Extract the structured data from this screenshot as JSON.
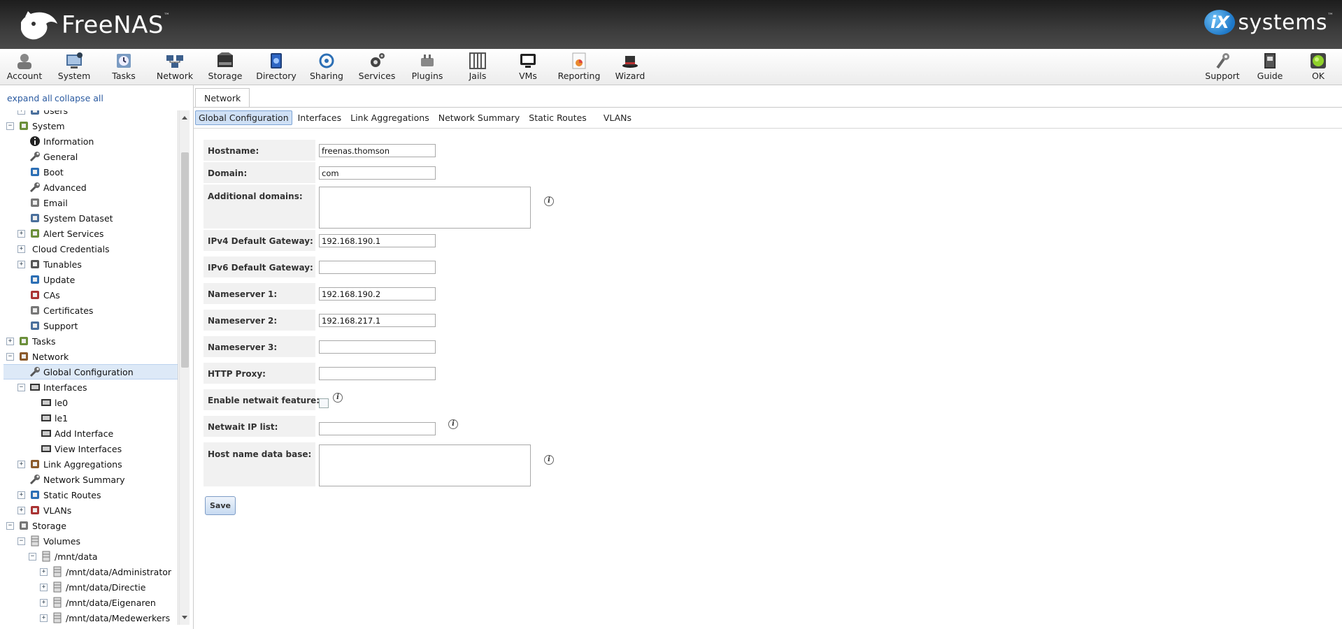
{
  "header": {
    "brand": "FreeNAS",
    "brand_tm": "™",
    "partner": "systems",
    "partner_mark": "iX",
    "partner_tm": "™"
  },
  "toolbar": {
    "items": [
      {
        "label": "Account",
        "icon": "account-icon"
      },
      {
        "label": "System",
        "icon": "system-icon"
      },
      {
        "label": "Tasks",
        "icon": "tasks-icon"
      },
      {
        "label": "Network",
        "icon": "network-icon"
      },
      {
        "label": "Storage",
        "icon": "storage-icon"
      },
      {
        "label": "Directory",
        "icon": "directory-icon"
      },
      {
        "label": "Sharing",
        "icon": "sharing-icon"
      },
      {
        "label": "Services",
        "icon": "services-icon"
      },
      {
        "label": "Plugins",
        "icon": "plugins-icon"
      },
      {
        "label": "Jails",
        "icon": "jails-icon"
      },
      {
        "label": "VMs",
        "icon": "vms-icon"
      },
      {
        "label": "Reporting",
        "icon": "reporting-icon"
      },
      {
        "label": "Wizard",
        "icon": "wizard-icon"
      }
    ],
    "right_items": [
      {
        "label": "Support",
        "icon": "support-icon"
      },
      {
        "label": "Guide",
        "icon": "guide-icon"
      },
      {
        "label": "OK",
        "icon": "alert-ok-icon"
      }
    ]
  },
  "tree": {
    "expand_all": "expand all",
    "collapse_all": "collapse all",
    "rows": [
      {
        "label": "Users",
        "level": 1,
        "exp": "+",
        "icon": "users-icon"
      },
      {
        "label": "System",
        "level": 0,
        "exp": "−",
        "icon": "system-icon"
      },
      {
        "label": "Information",
        "level": 1,
        "exp": "",
        "icon": "info-icon"
      },
      {
        "label": "General",
        "level": 1,
        "exp": "",
        "icon": "wrench-icon"
      },
      {
        "label": "Boot",
        "level": 1,
        "exp": "",
        "icon": "boot-icon"
      },
      {
        "label": "Advanced",
        "level": 1,
        "exp": "",
        "icon": "wrench-icon"
      },
      {
        "label": "Email",
        "level": 1,
        "exp": "",
        "icon": "email-icon"
      },
      {
        "label": "System Dataset",
        "level": 1,
        "exp": "",
        "icon": "dataset-icon"
      },
      {
        "label": "Alert Services",
        "level": 1,
        "exp": "+",
        "icon": "alert-icon"
      },
      {
        "label": "Cloud Credentials",
        "level": 1,
        "exp": "+",
        "icon": ""
      },
      {
        "label": "Tunables",
        "level": 1,
        "exp": "+",
        "icon": "tunables-icon"
      },
      {
        "label": "Update",
        "level": 1,
        "exp": "",
        "icon": "update-icon"
      },
      {
        "label": "CAs",
        "level": 1,
        "exp": "",
        "icon": "ca-icon"
      },
      {
        "label": "Certificates",
        "level": 1,
        "exp": "",
        "icon": "certificate-icon"
      },
      {
        "label": "Support",
        "level": 1,
        "exp": "",
        "icon": "support-icon"
      },
      {
        "label": "Tasks",
        "level": 0,
        "exp": "+",
        "icon": "tasks-icon"
      },
      {
        "label": "Network",
        "level": 0,
        "exp": "−",
        "icon": "network-icon"
      },
      {
        "label": "Global Configuration",
        "level": 1,
        "exp": "",
        "icon": "wrench-icon",
        "selected": true
      },
      {
        "label": "Interfaces",
        "level": 1,
        "exp": "−",
        "icon": "interface-icon"
      },
      {
        "label": "le0",
        "level": 2,
        "exp": "",
        "icon": "interface-icon"
      },
      {
        "label": "le1",
        "level": 2,
        "exp": "",
        "icon": "interface-icon"
      },
      {
        "label": "Add Interface",
        "level": 2,
        "exp": "",
        "icon": "add-interface-icon"
      },
      {
        "label": "View Interfaces",
        "level": 2,
        "exp": "",
        "icon": "view-interfaces-icon"
      },
      {
        "label": "Link Aggregations",
        "level": 1,
        "exp": "+",
        "icon": "link-aggregation-icon"
      },
      {
        "label": "Network Summary",
        "level": 1,
        "exp": "",
        "icon": "wrench-icon"
      },
      {
        "label": "Static Routes",
        "level": 1,
        "exp": "+",
        "icon": "static-routes-icon"
      },
      {
        "label": "VLANs",
        "level": 1,
        "exp": "+",
        "icon": "vlan-icon"
      },
      {
        "label": "Storage",
        "level": 0,
        "exp": "−",
        "icon": "storage-icon"
      },
      {
        "label": "Volumes",
        "level": 1,
        "exp": "−",
        "icon": "volume-icon"
      },
      {
        "label": "/mnt/data",
        "level": 2,
        "exp": "−",
        "icon": "volume-icon"
      },
      {
        "label": "/mnt/data/Administrator",
        "level": 3,
        "exp": "+",
        "icon": "volume-icon"
      },
      {
        "label": "/mnt/data/Directie",
        "level": 3,
        "exp": "+",
        "icon": "volume-icon"
      },
      {
        "label": "/mnt/data/Eigenaren",
        "level": 3,
        "exp": "+",
        "icon": "volume-icon"
      },
      {
        "label": "/mnt/data/Medewerkers",
        "level": 3,
        "exp": "+",
        "icon": "volume-icon"
      }
    ]
  },
  "main": {
    "tab": "Network",
    "subtabs": [
      "Global Configuration",
      "Interfaces",
      "Link Aggregations",
      "Network Summary",
      "Static Routes",
      "VLANs"
    ],
    "form": {
      "hostname": {
        "label": "Hostname:",
        "value": "freenas.thomson"
      },
      "domain": {
        "label": "Domain:",
        "value": "com"
      },
      "additional_domains": {
        "label": "Additional domains:",
        "value": ""
      },
      "ipv4_gateway": {
        "label": "IPv4 Default Gateway:",
        "value": "192.168.190.1"
      },
      "ipv6_gateway": {
        "label": "IPv6 Default Gateway:",
        "value": ""
      },
      "nameserver1": {
        "label": "Nameserver 1:",
        "value": "192.168.190.2"
      },
      "nameserver2": {
        "label": "Nameserver 2:",
        "value": "192.168.217.1"
      },
      "nameserver3": {
        "label": "Nameserver 3:",
        "value": ""
      },
      "http_proxy": {
        "label": "HTTP Proxy:",
        "value": ""
      },
      "netwait": {
        "label": "Enable netwait feature:",
        "checked": false
      },
      "netwait_ip": {
        "label": "Netwait IP list:",
        "value": ""
      },
      "hosts": {
        "label": "Host name data base:",
        "value": ""
      }
    },
    "save_label": "Save",
    "help_glyph": "i"
  }
}
